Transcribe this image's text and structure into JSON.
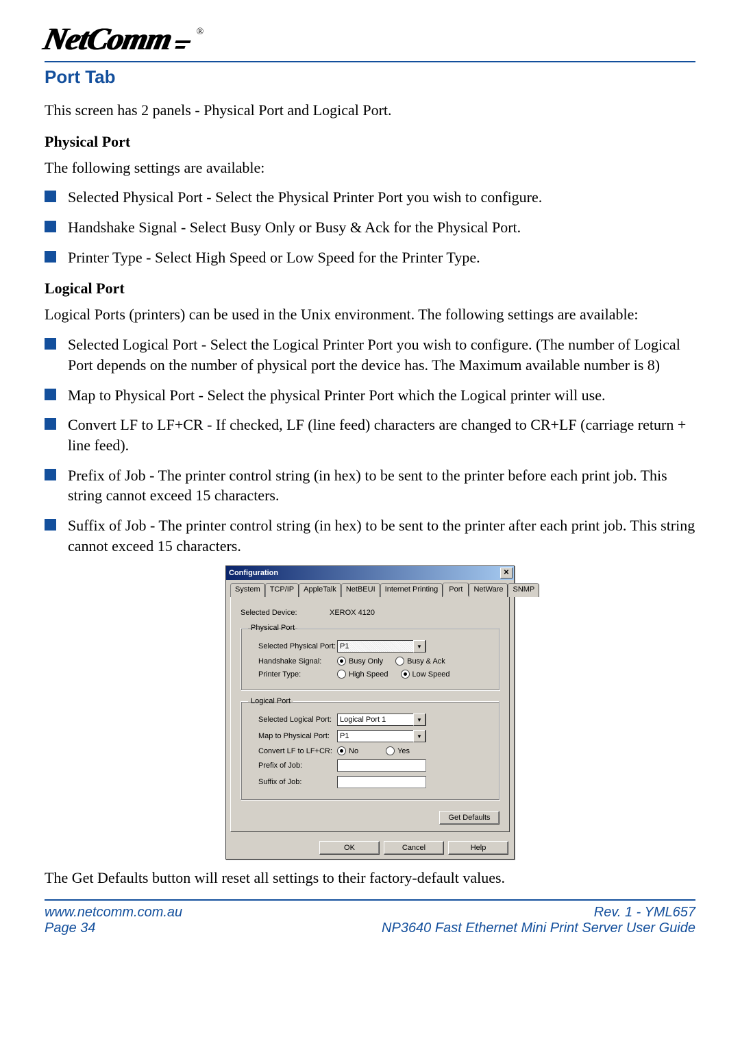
{
  "logo_text": "NetComm",
  "header": {
    "title": "Port Tab"
  },
  "intro": "This screen has 2 panels - Physical Port and Logical Port.",
  "physical": {
    "heading": "Physical Port",
    "lead": "The following settings are available:",
    "items": [
      "Selected Physical Port - Select the Physical Printer Port you wish to configure.",
      "Handshake Signal - Select Busy Only or Busy & Ack for the Physical Port.",
      "Printer Type - Select High Speed or Low Speed for the Printer Type."
    ]
  },
  "logical": {
    "heading": "Logical Port",
    "lead": "Logical Ports (printers) can be used in the Unix environment. The following settings are available:",
    "items": [
      "Selected Logical Port - Select the Logical Printer Port you wish to configure. (The number of Logical Port depends on the number of physical port the device has. The Maximum available number is 8)",
      "Map to Physical Port - Select the physical Printer Port which the Logical printer will use.",
      "Convert LF to LF+CR - If checked, LF (line feed) characters are changed to CR+LF (carriage return + line feed).",
      "Prefix of Job - The printer control string (in hex) to be sent to the printer before each print job. This string cannot exceed 15 characters.",
      "Suffix of Job - The printer control string (in hex) to be sent to the printer after each print job. This string cannot exceed 15 characters."
    ]
  },
  "dialog": {
    "title": "Configuration",
    "close_glyph": "✕",
    "tabs": [
      "System",
      "TCP/IP",
      "AppleTalk",
      "NetBEUI",
      "Internet Printing",
      "Port",
      "NetWare",
      "SNMP"
    ],
    "active_tab": "Port",
    "selected_device_label": "Selected Device:",
    "selected_device_value": "XEROX 4120",
    "physical_group": "Physical Port",
    "sel_phys_label": "Selected Physical Port:",
    "sel_phys_value": "P1",
    "handshake_label": "Handshake Signal:",
    "handshake_opts": [
      "Busy Only",
      "Busy & Ack"
    ],
    "printer_type_label": "Printer Type:",
    "printer_type_opts": [
      "High Speed",
      "Low Speed"
    ],
    "logical_group": "Logical Port",
    "sel_log_label": "Selected Logical Port:",
    "sel_log_value": "Logical Port 1",
    "map_label": "Map to Physical Port:",
    "map_value": "P1",
    "convert_label": "Convert LF to LF+CR:",
    "convert_opts": [
      "No",
      "Yes"
    ],
    "prefix_label": "Prefix of Job:",
    "suffix_label": "Suffix of Job:",
    "get_defaults": "Get Defaults",
    "ok": "OK",
    "cancel": "Cancel",
    "help": "Help"
  },
  "outro": "The Get Defaults button will reset all settings to their factory-default values.",
  "footer": {
    "url": "www.netcomm.com.au",
    "rev": "Rev. 1 - YML657",
    "page": "Page 34",
    "guide": "NP3640  Fast Ethernet Mini Print Server User Guide"
  }
}
